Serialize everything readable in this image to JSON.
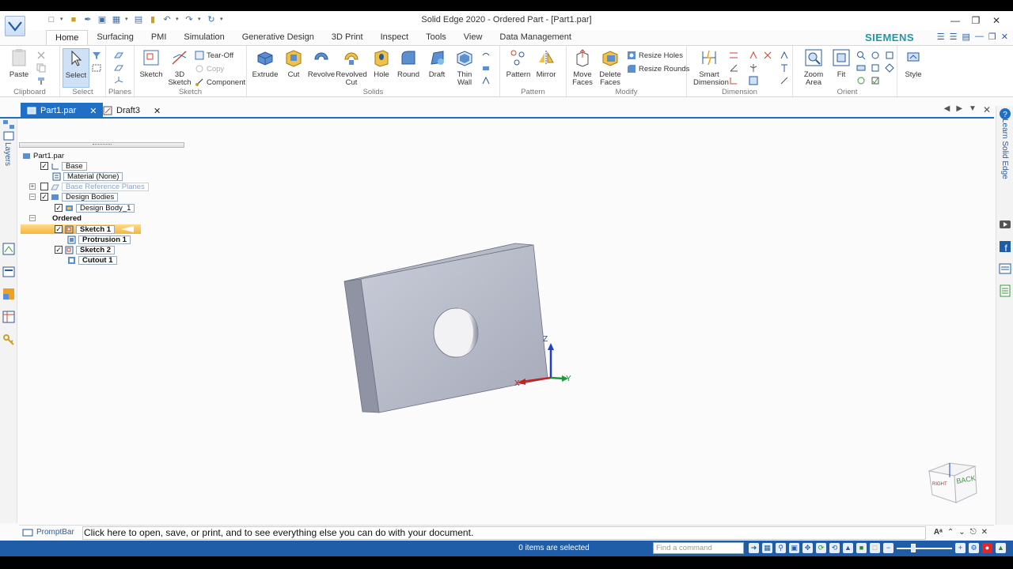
{
  "window": {
    "title": "Solid Edge 2020 - Ordered Part - [Part1.par]"
  },
  "ribbon": {
    "tabs": [
      "Home",
      "Surfacing",
      "PMI",
      "Simulation",
      "Generative Design",
      "3D Print",
      "Inspect",
      "Tools",
      "View",
      "Data Management"
    ],
    "brand": "SIEMENS",
    "groups": {
      "clipboard": {
        "label": "Clipboard",
        "paste": "Paste"
      },
      "select": {
        "label": "Select",
        "select": "Select"
      },
      "planes": {
        "label": "Planes"
      },
      "sketch": {
        "label": "Sketch",
        "sketch": "Sketch",
        "sketch3d_l1": "3D",
        "sketch3d_l2": "Sketch",
        "tear_off": "Tear-Off",
        "copy": "Copy",
        "component": "Component"
      },
      "solids": {
        "label": "Solids",
        "extrude": "Extrude",
        "cut": "Cut",
        "revolve": "Revolve",
        "revolved_cut_l1": "Revolved",
        "revolved_cut_l2": "Cut",
        "hole": "Hole",
        "round": "Round",
        "draft": "Draft",
        "thin_wall_l1": "Thin",
        "thin_wall_l2": "Wall"
      },
      "pattern": {
        "label": "Pattern",
        "pattern": "Pattern",
        "mirror": "Mirror"
      },
      "modify": {
        "label": "Modify",
        "move_faces_l1": "Move",
        "move_faces_l2": "Faces",
        "delete_faces_l1": "Delete",
        "delete_faces_l2": "Faces",
        "resize_holes": "Resize Holes",
        "resize_rounds": "Resize Rounds"
      },
      "dimension": {
        "label": "Dimension",
        "smart_l1": "Smart",
        "smart_l2": "Dimension"
      },
      "orient": {
        "label": "Orient",
        "zoom_l1": "Zoom",
        "zoom_l2": "Area",
        "fit": "Fit"
      },
      "style": {
        "label": "Style"
      }
    }
  },
  "doc_tabs": [
    {
      "label": "Part1.par",
      "active": true
    },
    {
      "label": "Draft3",
      "active": false
    }
  ],
  "left_strip": {
    "layers": "Layers"
  },
  "right_strip": {
    "learn": "Learn Solid Edge"
  },
  "pathfinder": {
    "root": "Part1.par",
    "base": "Base",
    "material": "Material (None)",
    "base_ref_planes": "Base Reference Planes",
    "design_bodies": "Design Bodies",
    "design_body_1": "Design Body_1",
    "ordered": "Ordered",
    "sketch1": "Sketch 1",
    "protrusion1": "Protrusion 1",
    "sketch2": "Sketch 2",
    "cutout1": "Cutout 1"
  },
  "viewport": {
    "axis_x": "X",
    "axis_y": "Y",
    "axis_z": "Z",
    "view_cube_face": "BACK",
    "view_cube_side": "RIGHT"
  },
  "promptbar": {
    "title": "PromptBar",
    "text": "Click here to open, save, or print, and to see everything else you can do with your document."
  },
  "statusbar": {
    "selection": "0 items are selected",
    "find_placeholder": "Find a command"
  },
  "colors": {
    "accent": "#1f6fc6",
    "status": "#1f5da8",
    "brand": "#1a9aa8",
    "ordered": "#f5b63b"
  }
}
